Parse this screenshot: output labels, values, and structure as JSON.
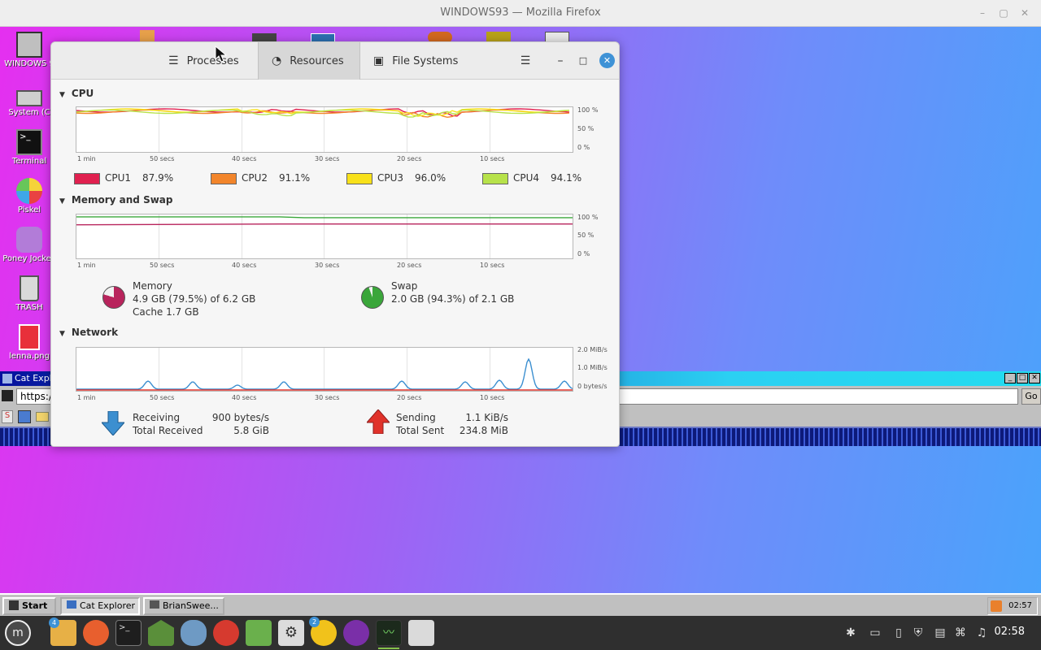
{
  "browser": {
    "title": "WINDOWS93 — Mozilla Firefox"
  },
  "desktop": {
    "icons": [
      {
        "label": "WINDOWS 9"
      },
      {
        "label": "System (C"
      },
      {
        "label": "Terminal"
      },
      {
        "label": "Piskel"
      },
      {
        "label": "Poney Jockey"
      },
      {
        "label": "TRASH"
      },
      {
        "label": "lenna.png"
      }
    ]
  },
  "cat_explorer": {
    "title": "Cat Expl",
    "url": "https://",
    "go_label": "Go"
  },
  "sysmon": {
    "tabs": [
      {
        "label": "Processes",
        "icon": "list-icon"
      },
      {
        "label": "Resources",
        "icon": "gauge-icon"
      },
      {
        "label": "File Systems",
        "icon": "disk-icon"
      }
    ],
    "x_labels": [
      "1 min",
      "50 secs",
      "40 secs",
      "30 secs",
      "20 secs",
      "10 secs"
    ],
    "cpu": {
      "title": "CPU",
      "y_labels": [
        "100 %",
        "50 %",
        "0 %"
      ],
      "cores": [
        {
          "name": "CPU1",
          "value": "87.9%",
          "color": "#e0204f"
        },
        {
          "name": "CPU2",
          "value": "91.1%",
          "color": "#f2852b"
        },
        {
          "name": "CPU3",
          "value": "96.0%",
          "color": "#f8e11a"
        },
        {
          "name": "CPU4",
          "value": "94.1%",
          "color": "#b7e24a"
        }
      ]
    },
    "memory": {
      "title": "Memory and Swap",
      "y_labels": [
        "100 %",
        "50 %",
        "0 %"
      ],
      "mem_label": "Memory",
      "mem_used": "4.9 GB (79.5%) of 6.2 GB",
      "mem_cache": "Cache 1.7 GB",
      "mem_percent": 79.5,
      "mem_color": "#b8245c",
      "swap_label": "Swap",
      "swap_used": "2.0 GB (94.3%) of 2.1 GB",
      "swap_percent": 94.3,
      "swap_color": "#3aa63a"
    },
    "network": {
      "title": "Network",
      "y_labels": [
        "2.0 MiB/s",
        "1.0 MiB/s",
        "0 bytes/s"
      ],
      "receiving_label": "Receiving",
      "receiving_value": "900 bytes/s",
      "total_received_label": "Total Received",
      "total_received_value": "5.8 GiB",
      "sending_label": "Sending",
      "sending_value": "1.1 KiB/s",
      "total_sent_label": "Total Sent",
      "total_sent_value": "234.8 MiB"
    }
  },
  "w93_taskbar": {
    "start_label": "Start",
    "tasks": [
      {
        "label": "Cat Explorer"
      },
      {
        "label": "BrianSwee..."
      }
    ],
    "clock": "02:57"
  },
  "mint_panel": {
    "clock": "02:58",
    "files_badge": "4",
    "bee_badge": "2"
  }
}
